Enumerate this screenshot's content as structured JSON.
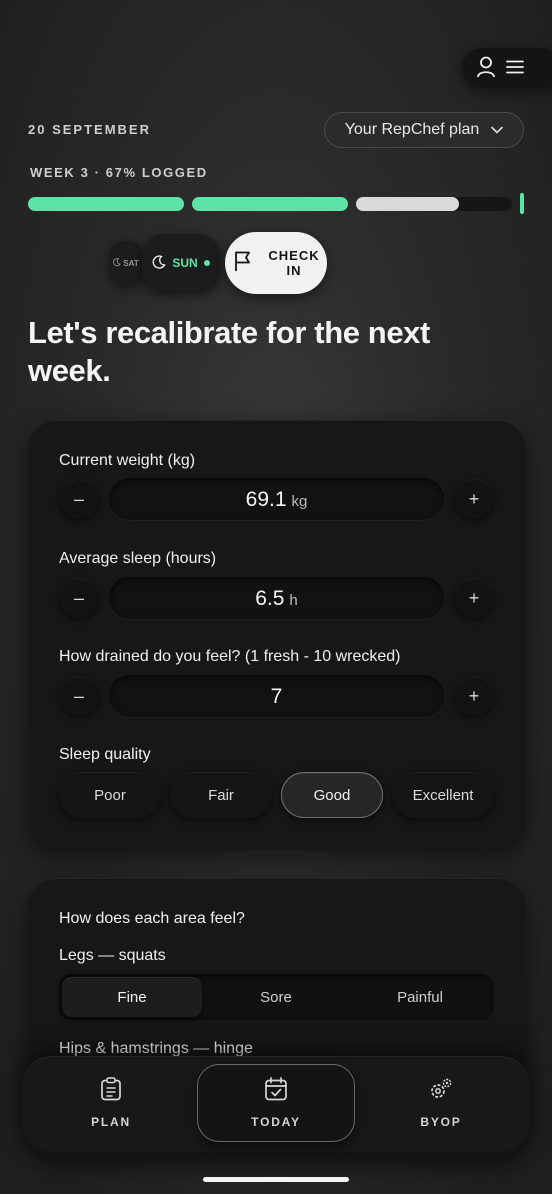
{
  "header": {
    "date": "20 SEPTEMBER",
    "plan_selector": "Your RepChef plan",
    "icons": [
      "user-icon",
      "menu-icon",
      "chevron-down-icon"
    ]
  },
  "progress": {
    "label": "WEEK 3 · 67% LOGGED",
    "segments": [
      {
        "fill": 1.0,
        "color": "#5ee3a6"
      },
      {
        "fill": 1.0,
        "color": "#5ee3a6"
      },
      {
        "fill": 0.66,
        "color": "#d9d9d9"
      }
    ]
  },
  "days": {
    "sat": "SAT",
    "sun": "SUN",
    "check_in": "CHECK IN"
  },
  "headline": "Let's recalibrate for the next week.",
  "metrics": {
    "weight": {
      "label": "Current weight (kg)",
      "value": "69.1",
      "unit": "kg"
    },
    "sleep": {
      "label": "Average sleep (hours)",
      "value": "6.5",
      "unit": "h"
    },
    "drained": {
      "label": "How drained do you feel? (1 fresh - 10 wrecked)",
      "value": "7",
      "unit": ""
    },
    "minus": "–",
    "plus": "+"
  },
  "sleep_quality": {
    "label": "Sleep quality",
    "options": [
      "Poor",
      "Fair",
      "Good",
      "Excellent"
    ],
    "selected": "Good"
  },
  "areas": {
    "title": "How does each area feel?",
    "legs_label": "Legs — squats",
    "options": [
      "Fine",
      "Sore",
      "Painful"
    ],
    "selected": "Fine",
    "next_label": "Hips & hamstrings — hinge"
  },
  "nav": {
    "plan": "PLAN",
    "today": "TODAY",
    "byop": "BYOP",
    "active": "TODAY"
  },
  "colors": {
    "accent": "#5ee3a6",
    "card": "#171717"
  }
}
